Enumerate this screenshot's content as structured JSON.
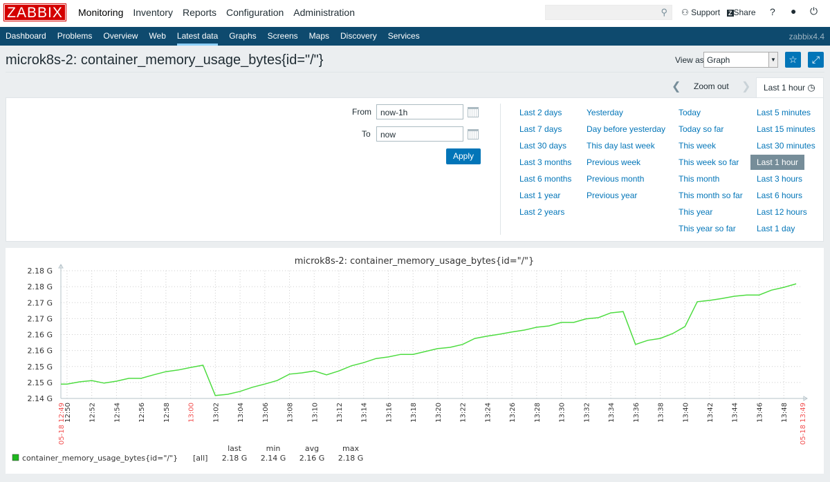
{
  "header": {
    "logo": "ZABBIX",
    "menu": [
      "Monitoring",
      "Inventory",
      "Reports",
      "Configuration",
      "Administration"
    ],
    "search_icon": "search-icon",
    "support": "Support",
    "share": "Share",
    "help": "?",
    "share_badge": "Z"
  },
  "submenu": {
    "items": [
      "Dashboard",
      "Problems",
      "Overview",
      "Web",
      "Latest data",
      "Graphs",
      "Screens",
      "Maps",
      "Discovery",
      "Services"
    ],
    "active": "Latest data",
    "version": "zabbix4.4"
  },
  "page": {
    "title": "microk8s-2: container_memory_usage_bytes{id=\"/\"}",
    "view_as_label": "View as",
    "view_as_value": "Graph"
  },
  "timebar": {
    "zoom_out": "Zoom out",
    "active_tab": "Last 1 hour"
  },
  "filter": {
    "from_label": "From",
    "from_value": "now-1h",
    "to_label": "To",
    "to_value": "now",
    "apply": "Apply",
    "columns": [
      [
        "Last 2 days",
        "Last 7 days",
        "Last 30 days",
        "Last 3 months",
        "Last 6 months",
        "Last 1 year",
        "Last 2 years"
      ],
      [
        "Yesterday",
        "Day before yesterday",
        "This day last week",
        "Previous week",
        "Previous month",
        "Previous year"
      ],
      [
        "Today",
        "Today so far",
        "This week",
        "This week so far",
        "This month",
        "This month so far",
        "This year",
        "This year so far"
      ],
      [
        "Last 5 minutes",
        "Last 15 minutes",
        "Last 30 minutes",
        "Last 1 hour",
        "Last 3 hours",
        "Last 6 hours",
        "Last 12 hours",
        "Last 1 day"
      ]
    ],
    "selected": "Last 1 hour"
  },
  "chart_data": {
    "type": "line",
    "title": "microk8s-2: container_memory_usage_bytes{id=\"/\"}",
    "ylim": [
      2.14,
      2.18
    ],
    "y_ticks": [
      "2.14 G",
      "2.15 G",
      "2.15 G",
      "2.16 G",
      "2.16 G",
      "2.17 G",
      "2.17 G",
      "2.18 G",
      "2.18 G"
    ],
    "xlim": [
      "12:49:30",
      "13:49:30"
    ],
    "x_ticks": [
      "12:50",
      "12:52",
      "12:54",
      "12:56",
      "12:58",
      "13:00",
      "13:02",
      "13:04",
      "13:06",
      "13:08",
      "13:10",
      "13:12",
      "13:14",
      "13:16",
      "13:18",
      "13:20",
      "13:22",
      "13:24",
      "13:26",
      "13:28",
      "13:30",
      "13:32",
      "13:34",
      "13:36",
      "13:38",
      "13:40",
      "13:42",
      "13:44",
      "13:46",
      "13:48"
    ],
    "x_edge_labels": [
      "05-18 12:49",
      "05-18 13:49"
    ],
    "highlight_tick": "13:00",
    "grid": true,
    "color": "#4ddc40",
    "series": [
      {
        "name": "container_memory_usage_bytes{id=\"/\"}",
        "x": [
          "12:49:30",
          "12:50",
          "12:51",
          "12:52",
          "12:53",
          "12:54",
          "12:55",
          "12:56",
          "12:57",
          "12:58",
          "12:59",
          "13:00",
          "13:01",
          "13:02",
          "13:03",
          "13:04",
          "13:05",
          "13:06",
          "13:07",
          "13:08",
          "13:09",
          "13:10",
          "13:11",
          "13:12",
          "13:13",
          "13:14",
          "13:15",
          "13:16",
          "13:17",
          "13:18",
          "13:19",
          "13:20",
          "13:21",
          "13:22",
          "13:23",
          "13:24",
          "13:25",
          "13:26",
          "13:27",
          "13:28",
          "13:29",
          "13:30",
          "13:31",
          "13:32",
          "13:33",
          "13:34",
          "13:35",
          "13:36",
          "13:37",
          "13:38",
          "13:39",
          "13:40",
          "13:41",
          "13:42",
          "13:43",
          "13:44",
          "13:45",
          "13:46",
          "13:47",
          "13:48",
          "13:49"
        ],
        "values": [
          2.1445,
          2.1445,
          2.1452,
          2.1456,
          2.1448,
          2.1454,
          2.1463,
          2.1463,
          2.1474,
          2.1484,
          2.1489,
          2.1497,
          2.1504,
          2.1409,
          2.1413,
          2.1422,
          2.1435,
          2.1445,
          2.1456,
          2.1476,
          2.148,
          2.1486,
          2.1474,
          2.1486,
          2.1502,
          2.1512,
          2.1525,
          2.153,
          2.1538,
          2.1538,
          2.1547,
          2.1556,
          2.156,
          2.1569,
          2.1588,
          2.1595,
          2.1601,
          2.1608,
          2.1614,
          2.1623,
          2.1627,
          2.1638,
          2.1638,
          2.1649,
          2.1653,
          2.1668,
          2.1672,
          2.1569,
          2.1582,
          2.1588,
          2.1603,
          2.1625,
          2.1703,
          2.1707,
          2.1713,
          2.172,
          2.1724,
          2.1724,
          2.1739,
          2.1748,
          2.1759
        ]
      }
    ],
    "legend": {
      "name": "container_memory_usage_bytes{id=\"/\"}",
      "func": "[all]",
      "headers": [
        "last",
        "min",
        "avg",
        "max"
      ],
      "values": [
        "2.18 G",
        "2.14 G",
        "2.16 G",
        "2.18 G"
      ]
    }
  }
}
